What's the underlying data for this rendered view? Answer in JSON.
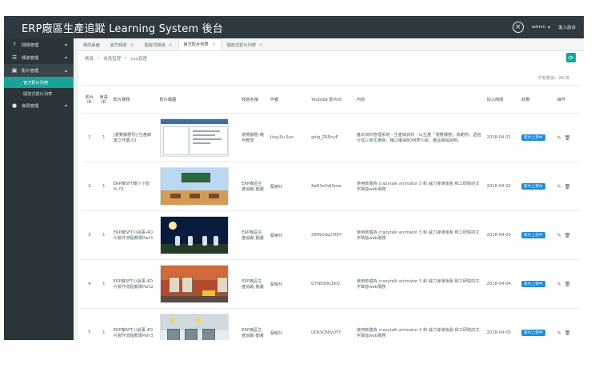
{
  "app": {
    "title": "ERP廠區生產追蹤 Learning System 後台",
    "user": "admin",
    "user_chevron": "▾",
    "right_link": "進入前台"
  },
  "sidebar": {
    "items": [
      {
        "icon": "help-icon",
        "label": "問題管理",
        "arrow": "▾"
      },
      {
        "icon": "list-icon",
        "label": "頻道管理",
        "arrow": "▾"
      },
      {
        "icon": "video-icon",
        "label": "影片管理",
        "arrow": "▴"
      },
      {
        "icon": "user-icon",
        "label": "會員管理",
        "arrow": "▾"
      }
    ],
    "subitems": [
      {
        "label": "官方影片列表",
        "active": true
      },
      {
        "label": "開放式影片列表",
        "active": false
      }
    ]
  },
  "tabs": [
    {
      "label": "我的桌面",
      "closable": false,
      "active": false
    },
    {
      "label": "官方頻道",
      "closable": true,
      "active": false
    },
    {
      "label": "開放式頻道",
      "closable": true,
      "active": false
    },
    {
      "label": "官方影片列表",
      "closable": true,
      "active": true
    },
    {
      "label": "開放式影片列表",
      "closable": true,
      "active": false
    }
  ],
  "breadcrumb": {
    "home": "首頁",
    "sep": ">",
    "level1": "會員管理",
    "level2": "xxx管理"
  },
  "table": {
    "total_text": "共有數據：88 條",
    "headers": [
      "影片ID",
      "會員ID",
      "影片標題",
      "影片截圖",
      "頻道名稱",
      "作者",
      "Youtube 影片ID",
      "內容",
      "加入時間",
      "狀態",
      "操作"
    ],
    "rows": [
      {
        "id": "1",
        "uid": "1",
        "title": "[瀏覽靜態列]-生產線建立作業-01",
        "category": "瀏覽靜態-廠列教學",
        "author": "Jing-Ru Sun",
        "youtube_id": "golq_ZKRnvE",
        "content": "基本資料管理系統 - 生產線資料 - 以生產「瀏覽靜態」為範例，透過分成三條生產線，藉以獲得BOM表介紹、產品製程說明。",
        "date": "2018-04-01",
        "status": "影片上架中",
        "ops_edit": "✎",
        "ops_delete": "🗑"
      },
      {
        "id": "2",
        "uid": "1",
        "title": "ERP廠SFT簡介小短片-01",
        "category": "ERP廠區生產追蹤-動畫",
        "author": "蔡曉玲",
        "youtube_id": "8aR3eOdj0mw",
        "content": "使用軟體為 crazytalk animator 3 和 威力導演後製 和工研院的文字聲音web服務",
        "date": "2018-04-02",
        "status": "影片上架中",
        "ops_edit": "✎",
        "ops_delete": "🗑"
      },
      {
        "id": "3",
        "uid": "1",
        "title": "ERP廠SFT小說事-4D片製作流程教學Part1",
        "category": "ERP廠區生產追蹤-動畫",
        "author": "蔡曉玲",
        "youtube_id": "ZWNOdq20I8Y",
        "content": "使用軟體為 crazytalk animator 3 和 威力導演後製 和工研院的文字聲音web服務",
        "date": "2018-04-03",
        "status": "影片上架中",
        "ops_edit": "✎",
        "ops_delete": "🗑"
      },
      {
        "id": "4",
        "uid": "1",
        "title": "ERP廠SFT小說事-4D片製作流程教學Part2",
        "category": "ERP廠區生產追蹤-動畫",
        "author": "蔡曉玲",
        "youtube_id": "QYNE9j6LEkQ",
        "content": "使用軟體為 crazytalk animator 3 和 威力導演後製 和工研院的文字聲音web服務",
        "date": "2018-04-04",
        "status": "影片上架中",
        "ops_edit": "✎",
        "ops_delete": "🗑"
      },
      {
        "id": "5",
        "uid": "1",
        "title": "ERP廠SFT小說事-4D片製作流程教學Part3",
        "category": "ERP廠區生產追蹤-動畫",
        "author": "蔡曉玲",
        "youtube_id": "UDk5QNfyOTY",
        "content": "使用軟體為 crazytalk animator 3 和 威力導演後製 和工研院的文字聲音web服務",
        "date": "2018-04-05",
        "status": "影片上架中",
        "ops_edit": "✎",
        "ops_delete": "🗑"
      }
    ]
  }
}
